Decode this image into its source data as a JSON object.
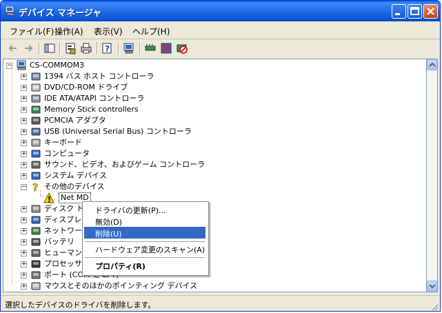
{
  "window": {
    "title": "デバイス マネージャ"
  },
  "menu": [
    "ファイル(F)",
    "操作(A)",
    "表示(V)",
    "ヘルプ(H)"
  ],
  "tree": {
    "root": "CS-COMMOM3",
    "items": [
      {
        "label": "1394 バス ホスト コントローラ",
        "icon": "bus-controller-icon"
      },
      {
        "label": "DVD/CD-ROM ドライブ",
        "icon": "cdrom-icon"
      },
      {
        "label": "IDE ATA/ATAPI コントローラ",
        "icon": "ide-controller-icon"
      },
      {
        "label": "Memory Stick controllers",
        "icon": "memory-stick-icon"
      },
      {
        "label": "PCMCIA アダプタ",
        "icon": "pcmcia-icon"
      },
      {
        "label": "USB (Universal Serial Bus) コントローラ",
        "icon": "usb-icon"
      },
      {
        "label": "キーボード",
        "icon": "keyboard-icon"
      },
      {
        "label": "コンピュータ",
        "icon": "computer-icon"
      },
      {
        "label": "サウンド、ビデオ、およびゲーム コントローラ",
        "icon": "sound-icon"
      },
      {
        "label": "システム デバイス",
        "icon": "system-device-icon"
      },
      {
        "label": "その他のデバイス",
        "icon": "unknown-device-icon"
      },
      {
        "label": "Net MD",
        "icon": "warning-device-icon"
      },
      {
        "label": "ディスク ドライブ",
        "icon": "disk-drive-icon"
      },
      {
        "label": "ディスプレイ アダプタ",
        "icon": "display-adapter-icon"
      },
      {
        "label": "ネットワーク アダプタ",
        "icon": "network-adapter-icon"
      },
      {
        "label": "バッテリ",
        "icon": "battery-icon"
      },
      {
        "label": "ヒューマン インターフェイス デバイス",
        "icon": "hid-icon"
      },
      {
        "label": "プロセッサ",
        "icon": "processor-icon"
      },
      {
        "label": "ポート (COM と LPT)",
        "icon": "port-icon"
      },
      {
        "label": "マウスとそのほかのポインティング デバイス",
        "icon": "mouse-icon"
      }
    ]
  },
  "context_menu": {
    "items": [
      "ドライバの更新(P)...",
      "無効(D)",
      "削除(U)",
      "ハードウェア変更のスキャン(A)",
      "プロパティ(R)"
    ]
  },
  "status": {
    "text": "選択したデバイスのドライバを削除します。"
  },
  "colors": {
    "selection": "#316ac5",
    "titlebar": "#0a5fe0",
    "window_bg": "#ece9d8"
  }
}
